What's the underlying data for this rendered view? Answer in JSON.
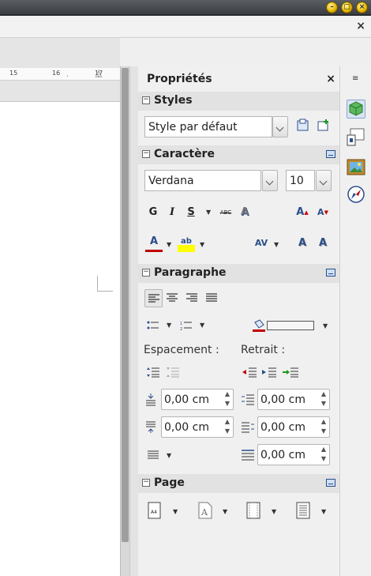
{
  "window": {
    "minimize_label": "–",
    "restore_label": "▢",
    "close_label": "×",
    "subbar_close": "×"
  },
  "ruler": {
    "ticks": [
      "15",
      "16",
      "·",
      "17"
    ]
  },
  "sidebar": {
    "title": "Propriétés",
    "close": "×",
    "sections": {
      "styles": {
        "title": "Styles",
        "style_value": "Style par défaut"
      },
      "character": {
        "title": "Caractère",
        "font_name": "Verdana",
        "font_size": "10",
        "bold": "G",
        "italic": "I",
        "underline": "S",
        "strike": "ABC",
        "shadow": "A",
        "grow": "A",
        "shrink": "A",
        "font_color": "A",
        "highlight": "ab",
        "spacing": "AV",
        "upper": "A",
        "lower": "A"
      },
      "paragraph": {
        "title": "Paragraphe",
        "spacing_label": "Espacement :",
        "indent_label": "Retrait :",
        "above_spacing": "0,00 cm",
        "below_spacing": "0,00 cm",
        "before_indent": "0,00 cm",
        "after_indent": "0,00 cm",
        "first_line_indent": "0,00 cm"
      },
      "page": {
        "title": "Page"
      }
    }
  },
  "tabbar": {
    "items": [
      "properties-tab",
      "styles-tab",
      "gallery-tab",
      "navigator-tab"
    ]
  },
  "colors": {
    "font_color": "#c00000",
    "highlight": "#ffff00",
    "accent": "#2a4e8a"
  }
}
